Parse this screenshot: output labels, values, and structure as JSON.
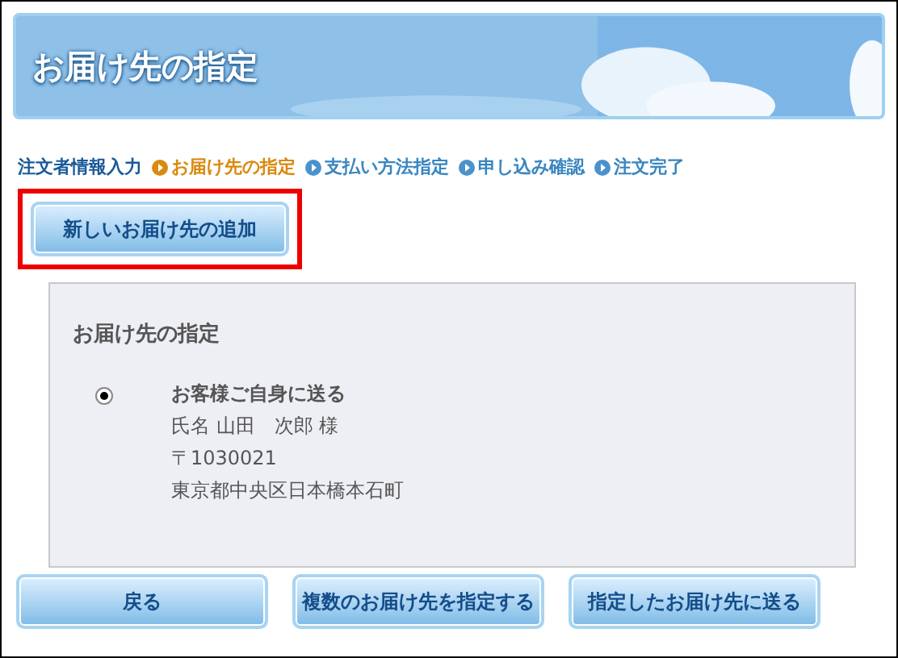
{
  "header": {
    "title": "お届け先の指定"
  },
  "steps": [
    {
      "label": "注文者情報入力",
      "kind": "done"
    },
    {
      "label": "お届け先の指定",
      "kind": "current"
    },
    {
      "label": "支払い方法指定",
      "kind": "upcoming"
    },
    {
      "label": "申し込み確認",
      "kind": "upcoming"
    },
    {
      "label": "注文完了",
      "kind": "upcoming"
    }
  ],
  "add_button": {
    "label": "新しいお届け先の追加",
    "highlighted": true
  },
  "panel": {
    "title": "お届け先の指定",
    "options": [
      {
        "label": "お客様ご自身に送る",
        "selected": true,
        "lines": [
          "氏名 山田　次郎 様",
          "〒1030021",
          "東京都中央区日本橋本石町"
        ]
      }
    ]
  },
  "buttons": [
    "戻る",
    "複数のお届け先を指定する",
    "指定したお届け先に送る"
  ]
}
